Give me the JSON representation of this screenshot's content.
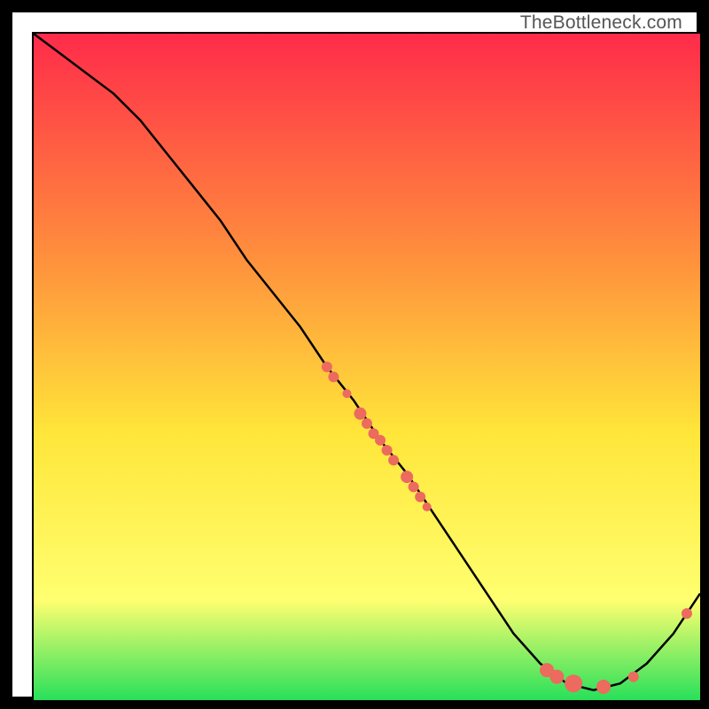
{
  "watermark": "TheBottleneck.com",
  "colors": {
    "gradient_top": "#ff2b4a",
    "gradient_mid1": "#ff943c",
    "gradient_mid2": "#ffe63a",
    "gradient_mid3": "#ffff70",
    "gradient_bottom": "#28e05a",
    "curve": "#000000",
    "marker_fill": "#ec6a5e",
    "marker_stroke": "#c94f44"
  },
  "chart_data": {
    "type": "line",
    "title": "",
    "xlabel": "",
    "ylabel": "",
    "xlim": [
      0,
      100
    ],
    "ylim": [
      0,
      100
    ],
    "grid": false,
    "legend": false,
    "series": [
      {
        "name": "bottleneck-curve",
        "x": [
          0,
          4,
          8,
          12,
          16,
          20,
          24,
          28,
          32,
          36,
          40,
          44,
          48,
          52,
          56,
          60,
          64,
          68,
          72,
          76,
          80,
          84,
          88,
          92,
          96,
          100
        ],
        "y": [
          100,
          97,
          94,
          91,
          87,
          82,
          77,
          72,
          66,
          61,
          56,
          50,
          45,
          39,
          34,
          28,
          22,
          16,
          10,
          5.5,
          2.5,
          1.5,
          2.5,
          5.5,
          10,
          16
        ]
      }
    ],
    "markers": [
      {
        "x": 44,
        "y": 50,
        "r": 6
      },
      {
        "x": 45,
        "y": 48.5,
        "r": 6
      },
      {
        "x": 47,
        "y": 46,
        "r": 5
      },
      {
        "x": 49,
        "y": 43,
        "r": 7
      },
      {
        "x": 50,
        "y": 41.5,
        "r": 6
      },
      {
        "x": 51,
        "y": 40,
        "r": 6
      },
      {
        "x": 52,
        "y": 39,
        "r": 6
      },
      {
        "x": 53,
        "y": 37.5,
        "r": 6
      },
      {
        "x": 54,
        "y": 36,
        "r": 6
      },
      {
        "x": 56,
        "y": 33.5,
        "r": 7
      },
      {
        "x": 57,
        "y": 32,
        "r": 6
      },
      {
        "x": 58,
        "y": 30.5,
        "r": 6
      },
      {
        "x": 59,
        "y": 29,
        "r": 5
      },
      {
        "x": 77,
        "y": 4.5,
        "r": 8
      },
      {
        "x": 78.5,
        "y": 3.5,
        "r": 8
      },
      {
        "x": 81,
        "y": 2.5,
        "r": 10
      },
      {
        "x": 85.5,
        "y": 2,
        "r": 8
      },
      {
        "x": 90,
        "y": 3.5,
        "r": 6
      },
      {
        "x": 98,
        "y": 13,
        "r": 6
      }
    ],
    "annotations": []
  }
}
